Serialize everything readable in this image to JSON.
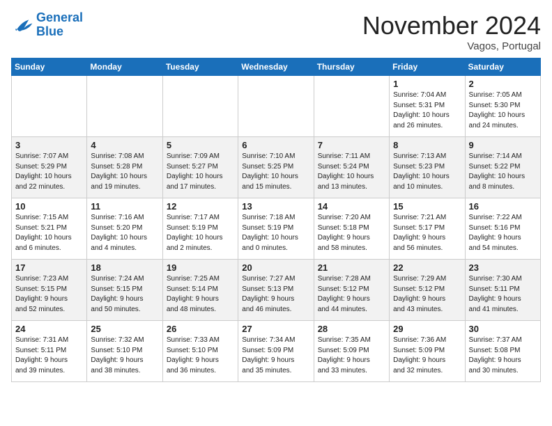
{
  "logo": {
    "line1": "General",
    "line2": "Blue"
  },
  "title": "November 2024",
  "location": "Vagos, Portugal",
  "weekdays": [
    "Sunday",
    "Monday",
    "Tuesday",
    "Wednesday",
    "Thursday",
    "Friday",
    "Saturday"
  ],
  "weeks": [
    [
      {
        "day": "",
        "info": ""
      },
      {
        "day": "",
        "info": ""
      },
      {
        "day": "",
        "info": ""
      },
      {
        "day": "",
        "info": ""
      },
      {
        "day": "",
        "info": ""
      },
      {
        "day": "1",
        "info": "Sunrise: 7:04 AM\nSunset: 5:31 PM\nDaylight: 10 hours\nand 26 minutes."
      },
      {
        "day": "2",
        "info": "Sunrise: 7:05 AM\nSunset: 5:30 PM\nDaylight: 10 hours\nand 24 minutes."
      }
    ],
    [
      {
        "day": "3",
        "info": "Sunrise: 7:07 AM\nSunset: 5:29 PM\nDaylight: 10 hours\nand 22 minutes."
      },
      {
        "day": "4",
        "info": "Sunrise: 7:08 AM\nSunset: 5:28 PM\nDaylight: 10 hours\nand 19 minutes."
      },
      {
        "day": "5",
        "info": "Sunrise: 7:09 AM\nSunset: 5:27 PM\nDaylight: 10 hours\nand 17 minutes."
      },
      {
        "day": "6",
        "info": "Sunrise: 7:10 AM\nSunset: 5:25 PM\nDaylight: 10 hours\nand 15 minutes."
      },
      {
        "day": "7",
        "info": "Sunrise: 7:11 AM\nSunset: 5:24 PM\nDaylight: 10 hours\nand 13 minutes."
      },
      {
        "day": "8",
        "info": "Sunrise: 7:13 AM\nSunset: 5:23 PM\nDaylight: 10 hours\nand 10 minutes."
      },
      {
        "day": "9",
        "info": "Sunrise: 7:14 AM\nSunset: 5:22 PM\nDaylight: 10 hours\nand 8 minutes."
      }
    ],
    [
      {
        "day": "10",
        "info": "Sunrise: 7:15 AM\nSunset: 5:21 PM\nDaylight: 10 hours\nand 6 minutes."
      },
      {
        "day": "11",
        "info": "Sunrise: 7:16 AM\nSunset: 5:20 PM\nDaylight: 10 hours\nand 4 minutes."
      },
      {
        "day": "12",
        "info": "Sunrise: 7:17 AM\nSunset: 5:19 PM\nDaylight: 10 hours\nand 2 minutes."
      },
      {
        "day": "13",
        "info": "Sunrise: 7:18 AM\nSunset: 5:19 PM\nDaylight: 10 hours\nand 0 minutes."
      },
      {
        "day": "14",
        "info": "Sunrise: 7:20 AM\nSunset: 5:18 PM\nDaylight: 9 hours\nand 58 minutes."
      },
      {
        "day": "15",
        "info": "Sunrise: 7:21 AM\nSunset: 5:17 PM\nDaylight: 9 hours\nand 56 minutes."
      },
      {
        "day": "16",
        "info": "Sunrise: 7:22 AM\nSunset: 5:16 PM\nDaylight: 9 hours\nand 54 minutes."
      }
    ],
    [
      {
        "day": "17",
        "info": "Sunrise: 7:23 AM\nSunset: 5:15 PM\nDaylight: 9 hours\nand 52 minutes."
      },
      {
        "day": "18",
        "info": "Sunrise: 7:24 AM\nSunset: 5:15 PM\nDaylight: 9 hours\nand 50 minutes."
      },
      {
        "day": "19",
        "info": "Sunrise: 7:25 AM\nSunset: 5:14 PM\nDaylight: 9 hours\nand 48 minutes."
      },
      {
        "day": "20",
        "info": "Sunrise: 7:27 AM\nSunset: 5:13 PM\nDaylight: 9 hours\nand 46 minutes."
      },
      {
        "day": "21",
        "info": "Sunrise: 7:28 AM\nSunset: 5:12 PM\nDaylight: 9 hours\nand 44 minutes."
      },
      {
        "day": "22",
        "info": "Sunrise: 7:29 AM\nSunset: 5:12 PM\nDaylight: 9 hours\nand 43 minutes."
      },
      {
        "day": "23",
        "info": "Sunrise: 7:30 AM\nSunset: 5:11 PM\nDaylight: 9 hours\nand 41 minutes."
      }
    ],
    [
      {
        "day": "24",
        "info": "Sunrise: 7:31 AM\nSunset: 5:11 PM\nDaylight: 9 hours\nand 39 minutes."
      },
      {
        "day": "25",
        "info": "Sunrise: 7:32 AM\nSunset: 5:10 PM\nDaylight: 9 hours\nand 38 minutes."
      },
      {
        "day": "26",
        "info": "Sunrise: 7:33 AM\nSunset: 5:10 PM\nDaylight: 9 hours\nand 36 minutes."
      },
      {
        "day": "27",
        "info": "Sunrise: 7:34 AM\nSunset: 5:09 PM\nDaylight: 9 hours\nand 35 minutes."
      },
      {
        "day": "28",
        "info": "Sunrise: 7:35 AM\nSunset: 5:09 PM\nDaylight: 9 hours\nand 33 minutes."
      },
      {
        "day": "29",
        "info": "Sunrise: 7:36 AM\nSunset: 5:09 PM\nDaylight: 9 hours\nand 32 minutes."
      },
      {
        "day": "30",
        "info": "Sunrise: 7:37 AM\nSunset: 5:08 PM\nDaylight: 9 hours\nand 30 minutes."
      }
    ]
  ]
}
